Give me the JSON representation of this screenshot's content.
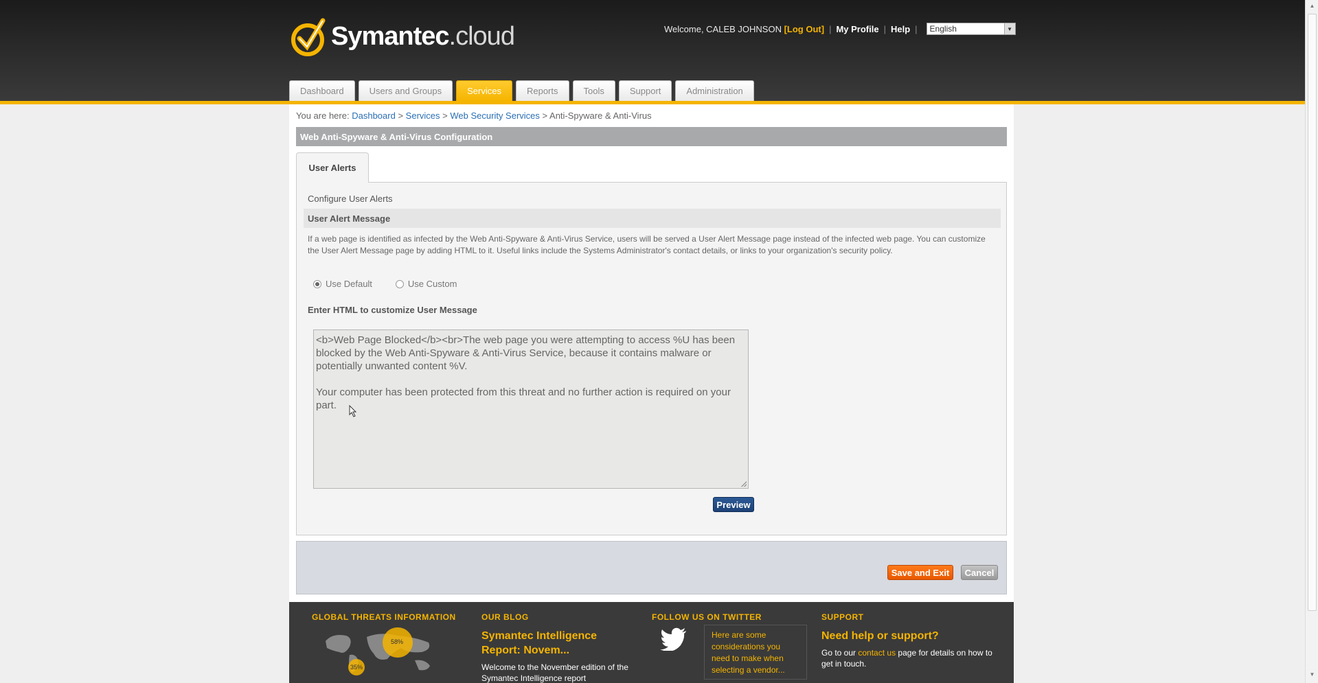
{
  "header": {
    "logo_main": "Symantec",
    "logo_suffix": ".cloud",
    "welcome": "Welcome, CALEB JOHNSON",
    "logout": "[Log Out]",
    "my_profile": "My Profile",
    "help": "Help",
    "language": "English"
  },
  "tabs": [
    "Dashboard",
    "Users and Groups",
    "Services",
    "Reports",
    "Tools",
    "Support",
    "Administration"
  ],
  "active_tab": "Services",
  "breadcrumb": {
    "prefix": "You are here:",
    "items": [
      "Dashboard",
      "Services",
      "Web Security Services"
    ],
    "current": "Anti-Spyware & Anti-Virus",
    "sep": ">"
  },
  "section_title": "Web Anti-Spyware & Anti-Virus Configuration",
  "inner_tab": "User Alerts",
  "panel": {
    "configure": "Configure User Alerts",
    "subheader": "User Alert Message",
    "description": "If a web page is identified as infected by the Web Anti-Spyware & Anti-Virus Service, users will be served a User Alert Message page instead of the infected web page. You can customize the User Alert Message page by adding HTML to it. Useful links include the Systems Administrator's contact details, or links to your organization's security policy.",
    "radio_default": "Use Default",
    "radio_custom": "Use Custom",
    "selected_option": "Use Default",
    "enter_label": "Enter HTML to customize User Message",
    "message": "<b>Web Page Blocked</b><br>The web page you were attempting to access %U has been blocked by the Web Anti-Spyware & Anti-Virus Service, because it contains malware or potentially unwanted content %V.\n\nYour computer has been protected from this threat and no further action is required on your part.",
    "preview": "Preview"
  },
  "actions": {
    "save": "Save and Exit",
    "cancel": "Cancel"
  },
  "footer": {
    "threats_head": "GLOBAL THREATS INFORMATION",
    "threat_pct_1": "58%",
    "threat_pct_2": "35%",
    "blog_head": "OUR BLOG",
    "blog_title": "Symantec Intelligence Report: Novem...",
    "blog_text": "Welcome to the November edition of the Symantec Intelligence report",
    "twitter_head": "FOLLOW US ON TWITTER",
    "tweet": "Here are some considerations you need to make when selecting a vendor...",
    "support_head": "SUPPORT",
    "support_title": "Need help or support?",
    "support_pre": "Go to our",
    "support_link": "contact us",
    "support_post": "page for details on how to get in touch."
  },
  "colors": {
    "accent": "#f5b400",
    "header_bg": "#2a2a2a",
    "save": "#ff6a00",
    "preview": "#1d4277"
  }
}
